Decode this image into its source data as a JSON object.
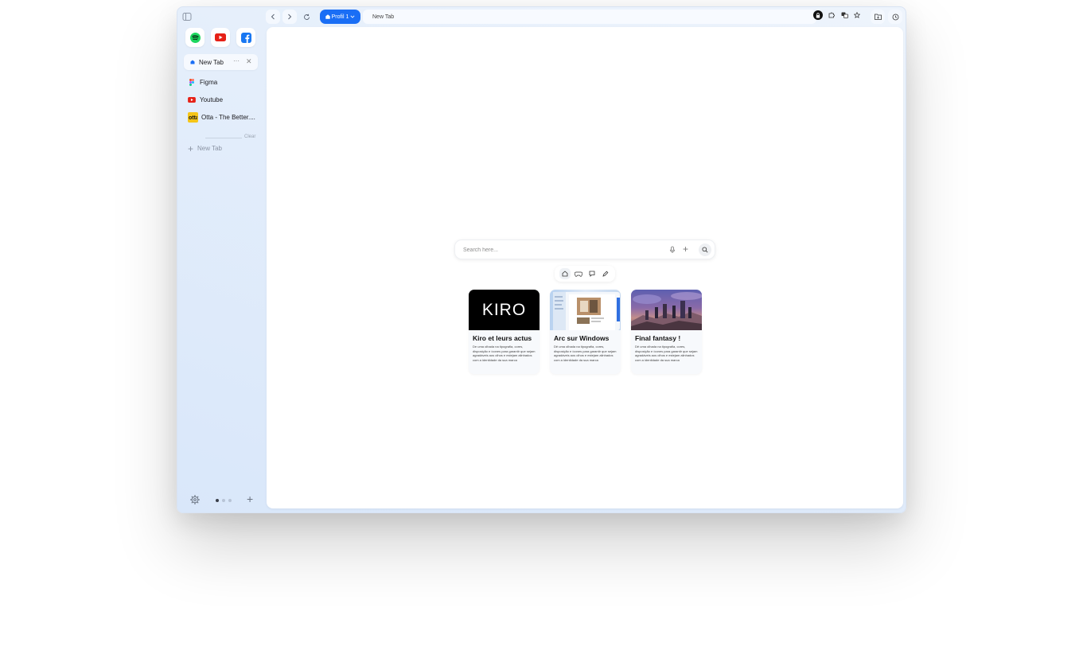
{
  "sidebar": {
    "pinned": [
      {
        "name": "spotify-icon"
      },
      {
        "name": "youtube-icon"
      },
      {
        "name": "facebook-icon"
      }
    ],
    "active_tab": {
      "label": "New Tab"
    },
    "tabs": [
      {
        "label": "Figma",
        "icon": "figma-icon"
      },
      {
        "label": "Youtube",
        "icon": "youtube-icon"
      },
      {
        "label": "Otta - The Better....",
        "icon": "otta-icon"
      }
    ],
    "clear_label": "Clear",
    "new_tab_label": "New Tab"
  },
  "toolbar": {
    "profile_label": "Profil 1",
    "url_text": "New Tab"
  },
  "search": {
    "placeholder": "Search here..."
  },
  "cards": [
    {
      "logo": "KIRO",
      "title": "Kiro et leurs actus",
      "desc": "De uma olhada na tipografia, cores, disposição e ícones para garantir que sejam agradáveis aos olhos e estejam alinhados com a identidade da sua marca"
    },
    {
      "title": "Arc sur Windows",
      "desc": "Dê uma olhada na tipografia, cores, disposição e ícones para garantir que sejam agradáveis aos olhos e estejam alinhados com a identidade da sua marca"
    },
    {
      "title": "Final fantasy !",
      "desc": "Dê uma olhada na tipografia, cores, disposição e ícones para garantir que sejam agradáveis aos olhos e estejam alinhados com a identidade da sua marca"
    }
  ],
  "colors": {
    "accent": "#1a6ef5",
    "spotify": "#1ed760",
    "youtube": "#e62117",
    "facebook": "#1877f2"
  }
}
